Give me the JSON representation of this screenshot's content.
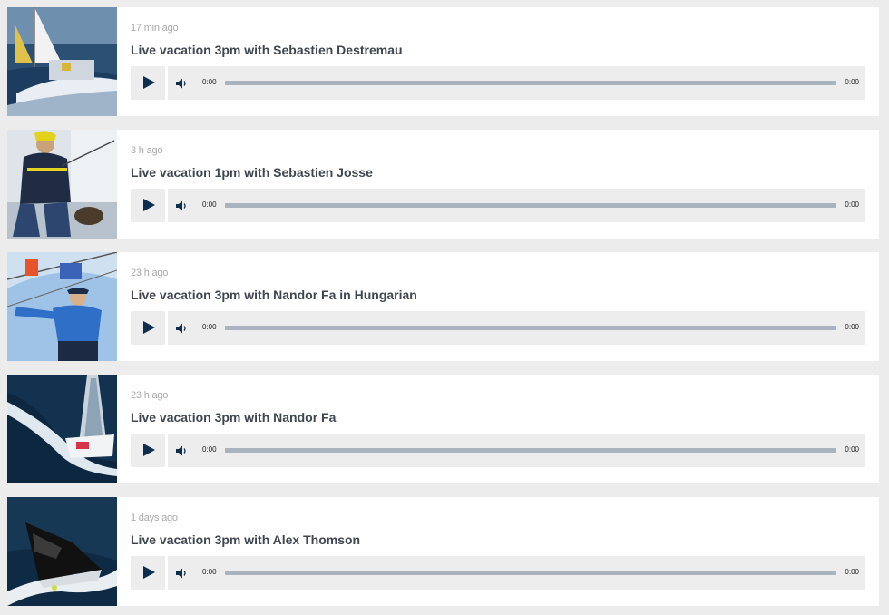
{
  "items": [
    {
      "time": "17 min ago",
      "title": "Live vacation 3pm with Sebastien Destremau",
      "current": "0:00",
      "duration": "0:00",
      "progress": 0,
      "image": "sailboat-deck-photo"
    },
    {
      "time": "3 h ago",
      "title": "Live vacation 1pm with Sebastien Josse",
      "current": "0:00",
      "duration": "0:00",
      "progress": 0,
      "image": "sailor-on-deck-photo"
    },
    {
      "time": "23 h ago",
      "title": "Live vacation 3pm with Nandor Fa in Hungarian",
      "current": "0:00",
      "duration": "0:00",
      "progress": 0,
      "image": "sailor-in-rigging-photo"
    },
    {
      "time": "23 h ago",
      "title": "Live vacation 3pm with Nandor Fa",
      "current": "0:00",
      "duration": "0:00",
      "progress": 0,
      "image": "aerial-yacht-photo"
    },
    {
      "time": "1 days ago",
      "title": "Live vacation 3pm with Alex Thomson",
      "current": "0:00",
      "duration": "0:00",
      "progress": 0,
      "image": "black-sail-yacht-photo"
    }
  ],
  "colors": {
    "play_icon": "#0e2e4d",
    "track": "#aab4c0",
    "player_bg": "#ededed",
    "title": "#3f4650",
    "time": "#a8a8a8"
  }
}
